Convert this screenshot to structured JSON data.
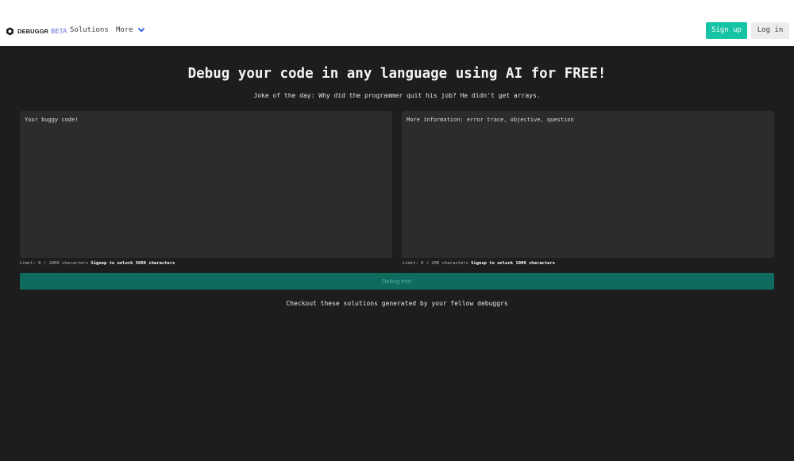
{
  "header": {
    "brand_name": "DEBUGGR",
    "brand_badge": "BETA",
    "nav": {
      "solutions": "Solutions",
      "more": "More"
    },
    "signup_label": "Sign up",
    "login_label": "Log in"
  },
  "main": {
    "title": "Debug your code in any language using AI for FREE!",
    "joke": "Joke of the day: Why did the programmer quit his job? He didn't get arrays.",
    "code_input": {
      "placeholder": "Your buggy code!",
      "limit_text": "Limit: 0 / 1000 characters",
      "unlock_text": "Signup to unlock 5000 characters"
    },
    "info_input": {
      "placeholder": "More information: error trace, objective, question",
      "limit_text": "Limit: 0 / 200 characters",
      "unlock_text": "Signup to unlock 1000 characters"
    },
    "debug_button": "Debug this!",
    "checkout_text": "Checkout these solutions generated by your fellow debuggrs"
  },
  "colors": {
    "accent": "#17c3a5",
    "debug_button_bg": "#0f6b5e",
    "background": "#1d1d1d",
    "panel": "#2c2c2c",
    "badge": "#5d6bd8"
  },
  "icons": {
    "logo": "hexagon-logo-icon",
    "more_dropdown": "chevron-down-icon"
  }
}
